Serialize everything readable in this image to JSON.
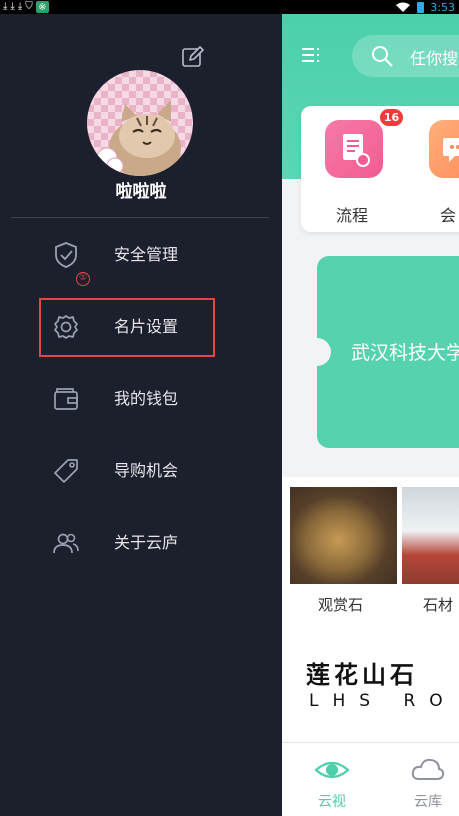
{
  "status_bar": {
    "time": "3:53",
    "left_icons": [
      "download-icon",
      "download-icon",
      "download-icon",
      "shield-icon",
      "app-badge-icon"
    ],
    "right_icons": [
      "wifi-icon",
      "battery-icon"
    ]
  },
  "drawer": {
    "username": "啦啦啦",
    "menu": [
      {
        "label": "安全管理",
        "icon": "shield-check-icon"
      },
      {
        "label": "名片设置",
        "icon": "gear-icon"
      },
      {
        "label": "我的钱包",
        "icon": "wallet-icon"
      },
      {
        "label": "导购机会",
        "icon": "tag-icon"
      },
      {
        "label": "关于云庐",
        "icon": "users-icon"
      }
    ],
    "annotation_marker": "①"
  },
  "main": {
    "search_placeholder": "任你搜",
    "apps": [
      {
        "label": "流程",
        "badge": "16"
      },
      {
        "label": "会"
      }
    ],
    "banner_text": "武汉科技大学",
    "gallery": [
      {
        "label": "观赏石"
      },
      {
        "label": "石材"
      }
    ],
    "logo_text": "莲花山石",
    "logo_sub": "LHS RO",
    "tabs": [
      {
        "label": "云视",
        "active": true
      },
      {
        "label": "云库",
        "active": false
      }
    ]
  },
  "colors": {
    "accent": "#4ccfab",
    "drawer_bg": "#1c1f2c",
    "highlight": "#e04848",
    "badge": "#f03b3b"
  }
}
